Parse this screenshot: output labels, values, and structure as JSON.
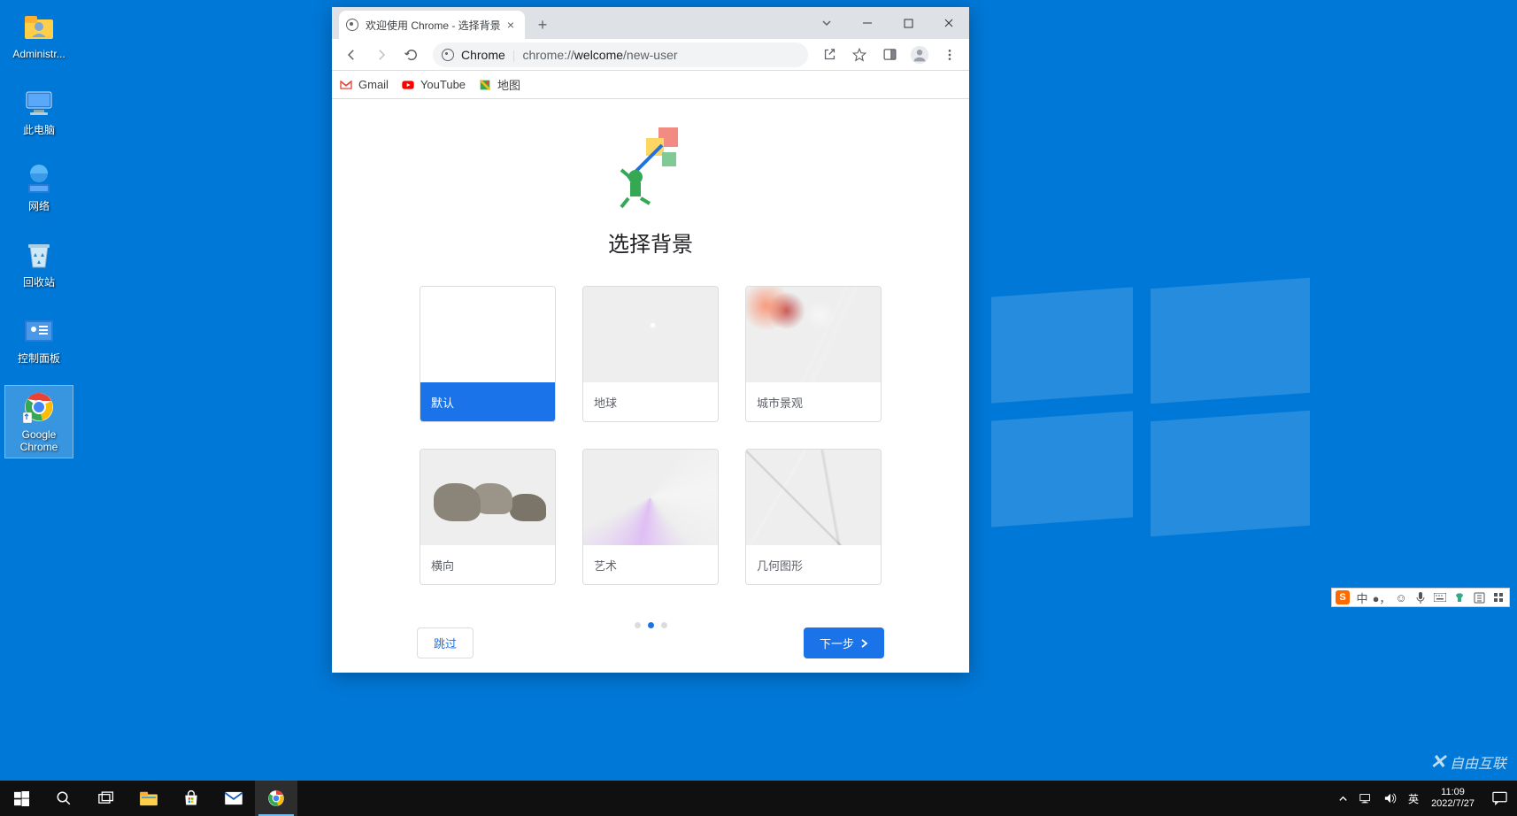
{
  "desktop": {
    "icons": [
      {
        "id": "administrator",
        "label": "Administr..."
      },
      {
        "id": "this-pc",
        "label": "此电脑"
      },
      {
        "id": "network",
        "label": "网络"
      },
      {
        "id": "recycle-bin",
        "label": "回收站"
      },
      {
        "id": "control-panel",
        "label": "控制面板"
      },
      {
        "id": "google-chrome",
        "label": "Google\nChrome"
      }
    ]
  },
  "chrome": {
    "tab_title": "欢迎使用 Chrome - 选择背景",
    "omnibox_host": "Chrome",
    "omnibox_prefix": "chrome://",
    "omnibox_strong": "welcome",
    "omnibox_rest": "/new-user",
    "bookmarks": [
      {
        "id": "gmail",
        "label": "Gmail"
      },
      {
        "id": "youtube",
        "label": "YouTube"
      },
      {
        "id": "maps",
        "label": "地图"
      }
    ],
    "page": {
      "heading": "选择背景",
      "cards": [
        {
          "id": "default",
          "label": "默认",
          "selected": true
        },
        {
          "id": "earth",
          "label": "地球"
        },
        {
          "id": "city",
          "label": "城市景观"
        },
        {
          "id": "landscape",
          "label": "横向"
        },
        {
          "id": "art",
          "label": "艺术"
        },
        {
          "id": "geometry",
          "label": "几何图形"
        }
      ],
      "skip": "跳过",
      "next": "下一步",
      "step_active": 1,
      "step_total": 3
    }
  },
  "ime": {
    "lang": "中"
  },
  "watermark": "自由互联",
  "taskbar": {
    "tray_lang": "英",
    "time": "11:09",
    "date": "2022/7/27"
  }
}
